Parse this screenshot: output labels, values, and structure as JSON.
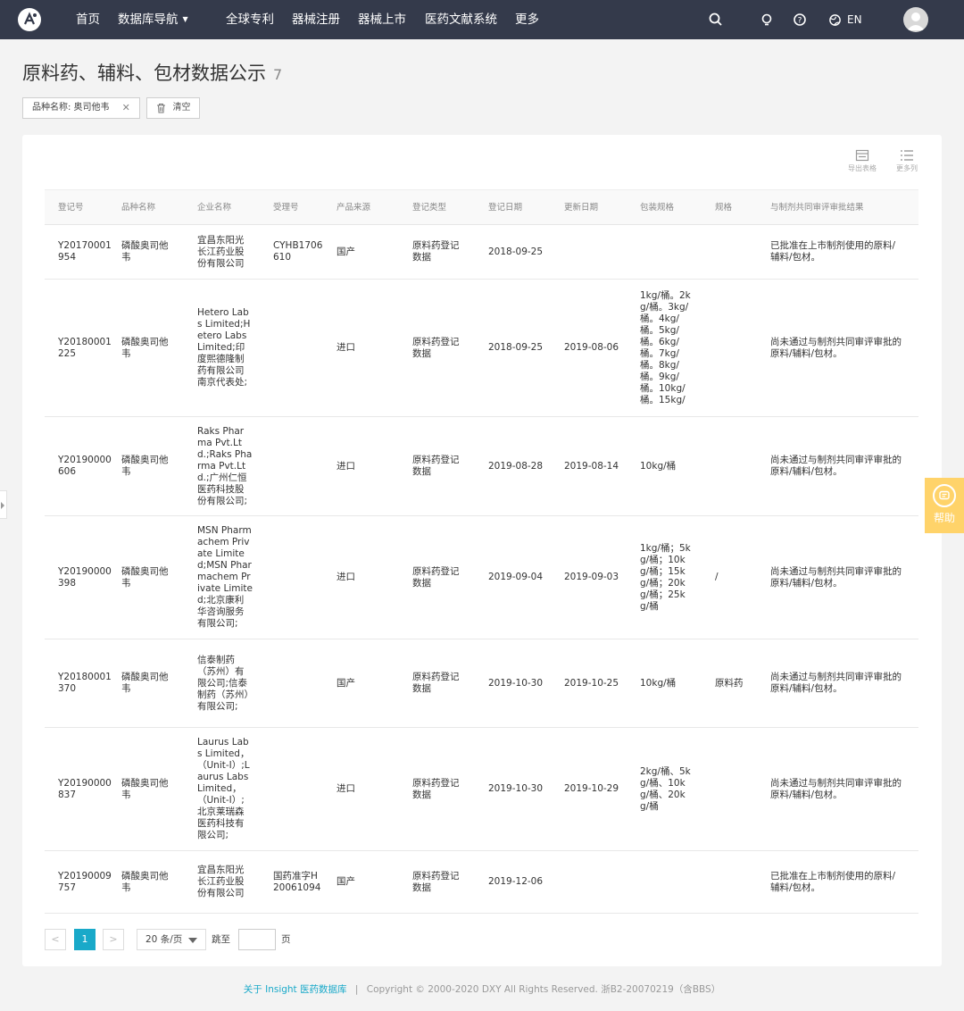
{
  "nav": {
    "items": [
      "首页",
      "数据库导航",
      "全球专利",
      "器械注册",
      "器械上市",
      "医药文献系统",
      "更多"
    ],
    "lang": "EN"
  },
  "page": {
    "title": "原料药、辅料、包材数据公示",
    "count": "7"
  },
  "filters": {
    "tag": "品种名称: 奥司他韦",
    "clear_label": "清空"
  },
  "tools": {
    "export_label": "导出表格",
    "more_cols_label": "更多列"
  },
  "table": {
    "headers": [
      "登记号",
      "品种名称",
      "企业名称",
      "受理号",
      "产品来源",
      "登记类型",
      "登记日期",
      "更新日期",
      "包装规格",
      "规格",
      "与制剂共同审评审批结果"
    ],
    "rows": [
      {
        "reg_no": "Y20170001954",
        "name": "磷酸奥司他韦",
        "company": "宜昌东阳光长江药业股份有限公司",
        "accept_no": "CYHB1706610",
        "source": "国产",
        "type": "原料药登记数据",
        "reg_date": "2018-09-25",
        "update_date": "",
        "package": "",
        "spec": "",
        "result": "已批准在上市制剂使用的原料/辅料/包材。"
      },
      {
        "reg_no": "Y20180001225",
        "name": "磷酸奥司他韦",
        "company": "Hetero Labs Limited;Hetero Labs Limited;印度熙德隆制药有限公司南京代表处;",
        "accept_no": "",
        "source": "进口",
        "type": "原料药登记数据",
        "reg_date": "2018-09-25",
        "update_date": "2019-08-06",
        "package": "1kg/桶。2kg/桶。3kg/桶。4kg/桶。5kg/桶。6kg/桶。7kg/桶。8kg/桶。9kg/桶。10kg/桶。15kg/",
        "spec": "",
        "result": "尚未通过与制剂共同审评审批的原料/辅料/包材。"
      },
      {
        "reg_no": "Y20190000606",
        "name": "磷酸奥司他韦",
        "company": "Raks Pharma Pvt.Ltd.;Raks Pharma Pvt.Ltd.;广州仁恒医药科技股份有限公司;",
        "accept_no": "",
        "source": "进口",
        "type": "原料药登记数据",
        "reg_date": "2019-08-28",
        "update_date": "2019-08-14",
        "package": "10kg/桶",
        "spec": "",
        "result": "尚未通过与制剂共同审评审批的原料/辅料/包材。"
      },
      {
        "reg_no": "Y20190000398",
        "name": "磷酸奥司他韦",
        "company": "MSN Pharmachem Private Limited;MSN Pharmachem Private Limited;北京康利华咨询服务有限公司;",
        "accept_no": "",
        "source": "进口",
        "type": "原料药登记数据",
        "reg_date": "2019-09-04",
        "update_date": "2019-09-03",
        "package": "1kg/桶；5kg/桶；10kg/桶；15kg/桶；20kg/桶；25kg/桶",
        "spec": "/",
        "result": "尚未通过与制剂共同审评审批的原料/辅料/包材。"
      },
      {
        "reg_no": "Y20180001370",
        "name": "磷酸奥司他韦",
        "company": "信泰制药（苏州）有限公司;信泰制药（苏州）有限公司;",
        "accept_no": "",
        "source": "国产",
        "type": "原料药登记数据",
        "reg_date": "2019-10-30",
        "update_date": "2019-10-25",
        "package": "10kg/桶",
        "spec": "原料药",
        "result": "尚未通过与制剂共同审评审批的原料/辅料/包材。"
      },
      {
        "reg_no": "Y20190000837",
        "name": "磷酸奥司他韦",
        "company": "Laurus Labs Limited，（Unit-I）;Laurus Labs Limited，（Unit-I）;北京莱瑞森医药科技有限公司;",
        "accept_no": "",
        "source": "进口",
        "type": "原料药登记数据",
        "reg_date": "2019-10-30",
        "update_date": "2019-10-29",
        "package": "2kg/桶、5kg/桶、10kg/桶、20kg/桶",
        "spec": "",
        "result": "尚未通过与制剂共同审评审批的原料/辅料/包材。"
      },
      {
        "reg_no": "Y20190009757",
        "name": "磷酸奥司他韦",
        "company": "宜昌东阳光长江药业股份有限公司",
        "accept_no": "国药准字H20061094",
        "source": "国产",
        "type": "原料药登记数据",
        "reg_date": "2019-12-06",
        "update_date": "",
        "package": "",
        "spec": "",
        "result": "已批准在上市制剂使用的原料/辅料/包材。"
      }
    ]
  },
  "pagination": {
    "prev": "<",
    "current": "1",
    "next": ">",
    "page_size": "20 条/页",
    "jump_label": "跳至",
    "page_suffix": "页"
  },
  "help": {
    "label": "帮助"
  },
  "footer": {
    "link": "关于 Insight 医药数据库",
    "sep": "|",
    "copyright": "Copyright © 2000-2020 DXY All Rights Reserved. 浙B2-20070219（含BBS）"
  },
  "colors": {
    "nav_bg": "#343a4b",
    "accent": "#19a9c9",
    "help_bg": "#ffd36a"
  }
}
